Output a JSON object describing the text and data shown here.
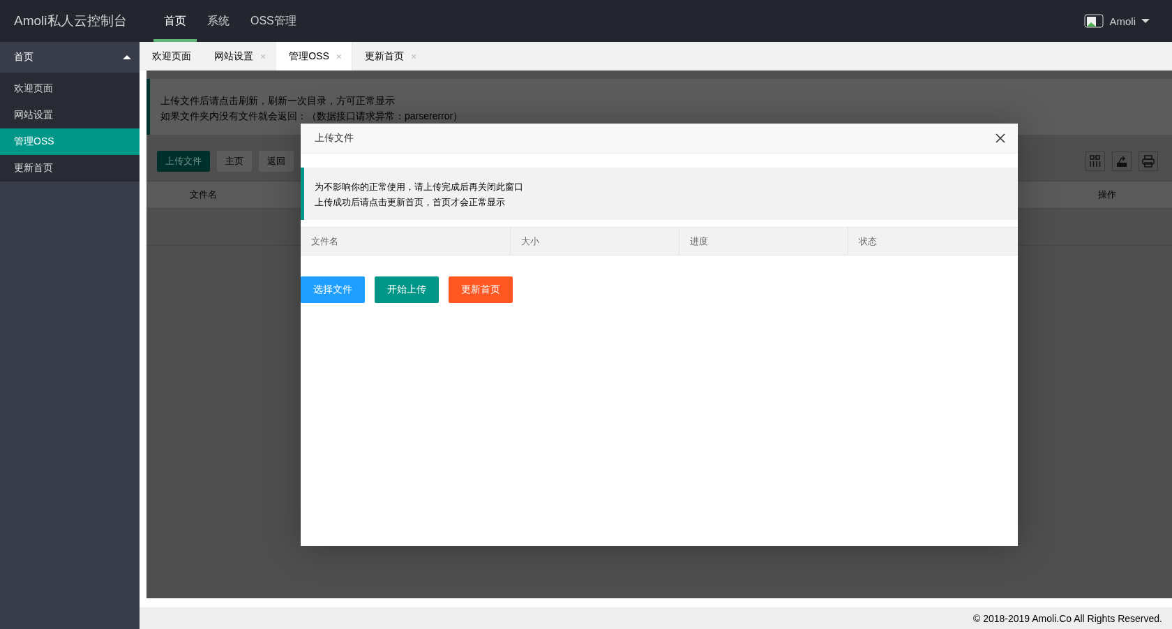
{
  "header": {
    "logo": "Amoli私人云控制台",
    "nav": [
      {
        "label": "首页",
        "selected": true
      },
      {
        "label": "系统",
        "selected": false
      },
      {
        "label": "OSS管理",
        "selected": false
      }
    ],
    "user": {
      "name": "Amoli"
    }
  },
  "sidebar": {
    "group": {
      "label": "首页",
      "expanded": true
    },
    "items": [
      {
        "label": "欢迎页面",
        "selected": false
      },
      {
        "label": "网站设置",
        "selected": false
      },
      {
        "label": "管理OSS",
        "selected": true
      },
      {
        "label": "更新首页",
        "selected": false
      }
    ]
  },
  "tabs": [
    {
      "label": "欢迎页面",
      "selected": false
    },
    {
      "label": "网站设置",
      "selected": false,
      "close": "×"
    },
    {
      "label": "管理OSS",
      "selected": true,
      "close": "×"
    },
    {
      "label": "更新首页",
      "selected": false,
      "close": "×"
    }
  ],
  "page": {
    "notice": [
      "上传文件后请点击刷新，刷新一次目录，方可正常显示",
      "如果文件夹内没有文件就会返回：（数据接口请求异常：parsererror）"
    ],
    "toolbar": [
      {
        "label": "上传文件",
        "kind": "primary"
      },
      {
        "label": "主页",
        "kind": "default"
      },
      {
        "label": "返回",
        "kind": "default"
      }
    ],
    "columns": [
      "文件名",
      "操作"
    ]
  },
  "dialog": {
    "title": "上传文件",
    "notice": [
      "为不影响你的正常使用，请上传完成后再关闭此窗口",
      "上传成功后请点击更新首页，首页才会正常显示"
    ],
    "columns": [
      "文件名",
      "大小",
      "进度",
      "状态"
    ],
    "buttons": [
      {
        "label": "选择文件",
        "color": "#1e9fff"
      },
      {
        "label": "开始上传",
        "color": "#009688"
      },
      {
        "label": "更新首页",
        "color": "#ff5722"
      }
    ]
  },
  "footer": {
    "copyright": "© 2018-2019 Amoli.Co All Rights Reserved."
  }
}
